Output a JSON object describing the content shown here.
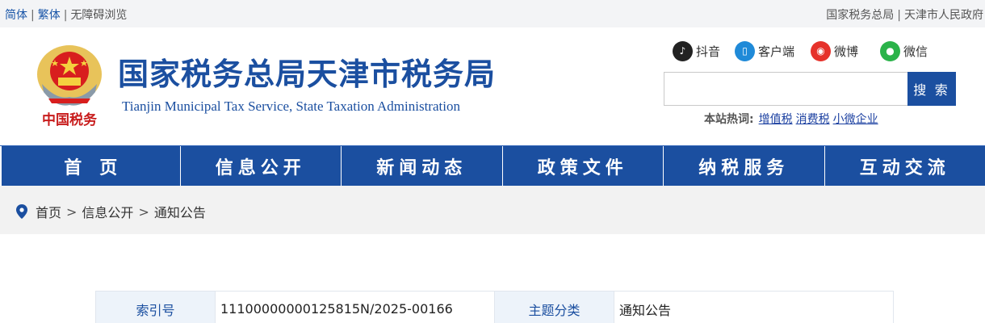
{
  "topbar": {
    "simplified": "简体",
    "traditional": "繁体",
    "accessible": "无障碍浏览",
    "sep": "|",
    "right_link1": "国家税务总局",
    "right_link2": "天津市人民政府"
  },
  "header": {
    "title": "国家税务总局天津市税务局",
    "subtitle": "Tianjin Municipal Tax Service, State Taxation Administration",
    "emblem_text": "中国税务",
    "social": {
      "douyin": "抖音",
      "client": "客户端",
      "weibo": "微博",
      "weixin": "微信"
    },
    "search": {
      "placeholder": "",
      "button": "搜 索"
    },
    "hotwords": {
      "label": "本站热词:",
      "items": [
        "增值税",
        "消费税",
        "小微企业"
      ]
    }
  },
  "nav": {
    "items": [
      "首页",
      "信息公开",
      "新闻动态",
      "政策文件",
      "纳税服务",
      "互动交流"
    ]
  },
  "breadcrumb": {
    "home": "首页",
    "level1": "信息公开",
    "level2": "通知公告",
    "sep": ">"
  },
  "meta": {
    "index_label": "索引号",
    "index_value": "11100000000125815N/2025-00166",
    "topic_label": "主题分类",
    "topic_value": "通知公告"
  },
  "colors": {
    "brand_blue": "#1b4fa0",
    "topbar_bg": "#f3f4f6",
    "crumb_bg": "#f2f2f2"
  }
}
